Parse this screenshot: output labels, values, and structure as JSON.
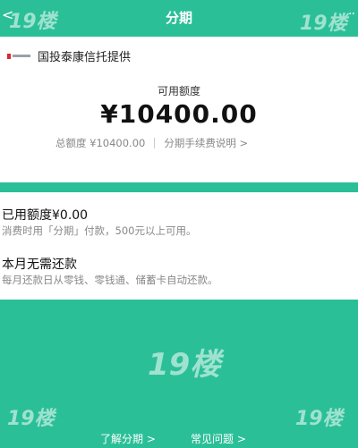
{
  "header": {
    "back_glyph": "<",
    "title": "分期",
    "more_glyph": "··"
  },
  "provider": {
    "text": "国投泰康信托提供"
  },
  "quota": {
    "available_label": "可用额度",
    "available_amount": "¥10400.00",
    "total_label": "总额度 ¥10400.00",
    "fee_link": "分期手续费说明 >"
  },
  "status": {
    "used": "已用额度¥0.00",
    "used_desc": "消费时用「分期」付款，500元以上可用。",
    "repay_title": "本月无需还款",
    "repay_desc": "每月还款日从零钱、零钱通、储蓄卡自动还款。"
  },
  "footer": {
    "learn": "了解分期 >",
    "faq": "常见问题 >"
  },
  "watermark": {
    "text": "19楼"
  },
  "colors": {
    "brand": "#2bbf98"
  }
}
